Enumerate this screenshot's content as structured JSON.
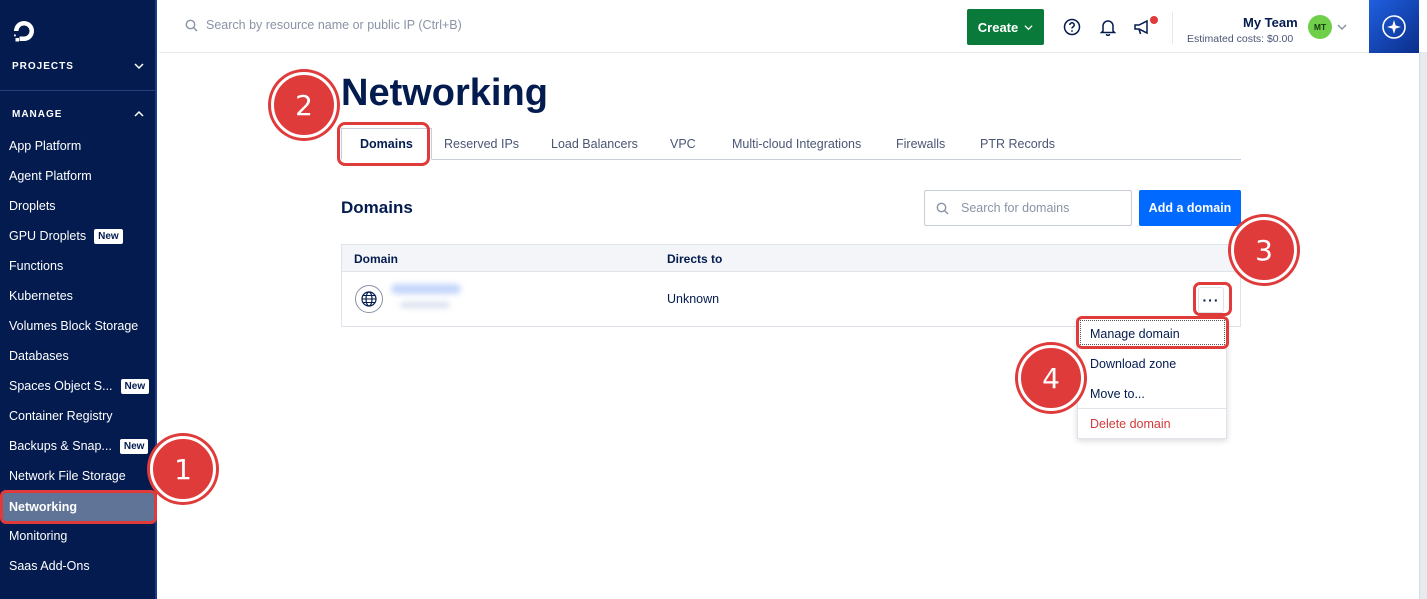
{
  "sidebar": {
    "projects_label": "PROJECTS",
    "manage_label": "MANAGE",
    "items": [
      {
        "label": "App Platform",
        "badge": ""
      },
      {
        "label": "Agent Platform",
        "badge": ""
      },
      {
        "label": "Droplets",
        "badge": ""
      },
      {
        "label": "GPU Droplets",
        "badge": "New"
      },
      {
        "label": "Functions",
        "badge": ""
      },
      {
        "label": "Kubernetes",
        "badge": ""
      },
      {
        "label": "Volumes Block Storage",
        "badge": ""
      },
      {
        "label": "Databases",
        "badge": ""
      },
      {
        "label": "Spaces Object S...",
        "badge": "New"
      },
      {
        "label": "Container Registry",
        "badge": ""
      },
      {
        "label": "Backups & Snap...",
        "badge": "New"
      },
      {
        "label": "Network File Storage",
        "badge": ""
      },
      {
        "label": "Networking",
        "badge": "",
        "active": true
      },
      {
        "label": "Monitoring",
        "badge": ""
      },
      {
        "label": "Saas Add-Ons",
        "badge": ""
      }
    ]
  },
  "topbar": {
    "search_placeholder": "Search by resource name or public IP (Ctrl+B)",
    "create_label": "Create",
    "team_name": "My Team",
    "estimated_costs": "Estimated costs: $0.00",
    "avatar_initials": "MT"
  },
  "page": {
    "title": "Networking",
    "tabs": [
      "Domains",
      "Reserved IPs",
      "Load Balancers",
      "VPC",
      "Multi-cloud Integrations",
      "Firewalls",
      "PTR Records"
    ],
    "active_tab": "Domains"
  },
  "domains": {
    "section_title": "Domains",
    "search_placeholder": "Search for domains",
    "add_button": "Add a domain",
    "columns": [
      "Domain",
      "Directs to"
    ],
    "rows": [
      {
        "directs_to": "Unknown"
      }
    ],
    "more_glyph": "···"
  },
  "dropdown": {
    "items": [
      "Manage domain",
      "Download zone",
      "Move to...",
      "Delete domain"
    ]
  },
  "markers": [
    "1",
    "2",
    "3",
    "4"
  ],
  "colors": {
    "sidebar_bg": "#031b4e",
    "primary_blue": "#0069ff",
    "create_green": "#0a7a3a",
    "highlight_red": "#e03b3b",
    "danger_red": "#d23a3a"
  }
}
